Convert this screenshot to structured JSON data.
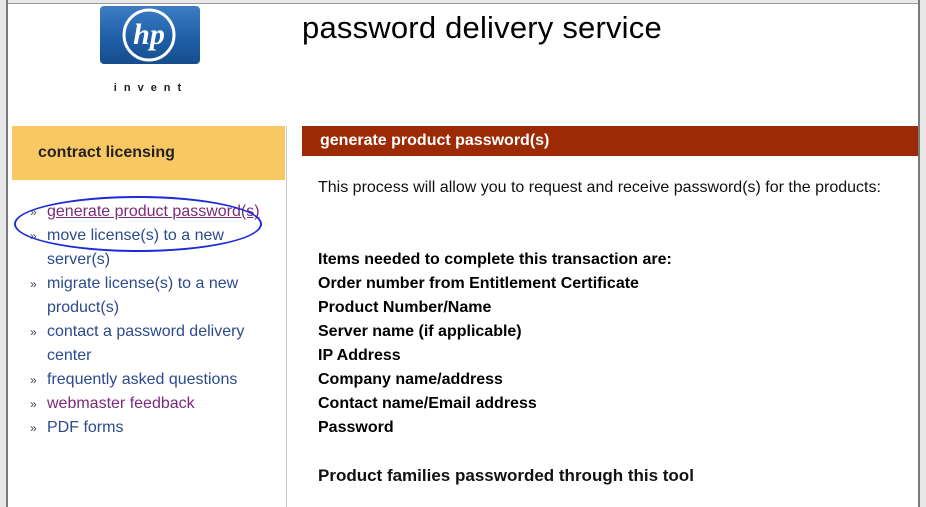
{
  "brand": {
    "logo_text": "hp",
    "tagline": "invent",
    "logo_color": "#1f5fa8"
  },
  "header": {
    "title": "password delivery service"
  },
  "sidebar": {
    "heading": "contract licensing",
    "heading_color": "#f9c862",
    "items": [
      {
        "label": "generate product password(s)",
        "state": "visited",
        "highlighted": true
      },
      {
        "label": "move license(s) to a new server(s)"
      },
      {
        "label": "migrate license(s) to a new product(s)"
      },
      {
        "label": "contact a password delivery center"
      },
      {
        "label": "frequently asked questions"
      },
      {
        "label": "webmaster feedback",
        "state": "visited"
      },
      {
        "label": "PDF forms"
      }
    ],
    "bullet": "»"
  },
  "main": {
    "section_title": "generate product password(s)",
    "section_color": "#9b2a05",
    "intro": "This process will allow you to request and receive password(s) for the products:",
    "requirements": [
      "Items needed to complete this transaction are:",
      "Order number from Entitlement Certificate",
      "Product Number/Name",
      "Server name (if applicable)",
      "IP Address",
      "Company name/address",
      "Contact name/Email address",
      "Password"
    ],
    "families_heading": "Product families passworded through this tool"
  }
}
